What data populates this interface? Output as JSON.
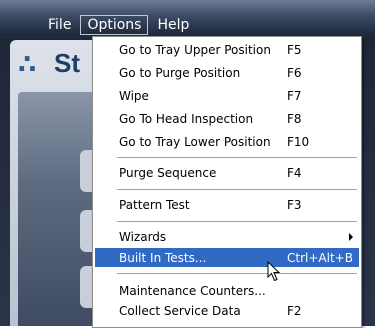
{
  "menubar": {
    "items": [
      {
        "label": "File"
      },
      {
        "label": "Options"
      },
      {
        "label": "Help"
      }
    ]
  },
  "app": {
    "logo_text": "St"
  },
  "options_menu": {
    "groups": [
      [
        {
          "label": "Go to Tray Upper Position",
          "shortcut": "F5"
        },
        {
          "label": "Go to Purge Position",
          "shortcut": "F6"
        },
        {
          "label": "Wipe",
          "shortcut": "F7"
        },
        {
          "label": "Go To Head Inspection",
          "shortcut": "F8"
        },
        {
          "label": "Go to Tray Lower Position",
          "shortcut": "F10"
        }
      ],
      [
        {
          "label": "Purge Sequence",
          "shortcut": "F4"
        }
      ],
      [
        {
          "label": "Pattern Test",
          "shortcut": "F3"
        }
      ],
      [
        {
          "label": "Wizards",
          "shortcut": "",
          "submenu": true
        },
        {
          "label": "Built In Tests...",
          "shortcut": "Ctrl+Alt+B",
          "highlighted": true
        }
      ],
      [
        {
          "label": "Maintenance Counters...",
          "shortcut": ""
        },
        {
          "label": "Collect Service Data",
          "shortcut": "F2"
        }
      ]
    ]
  },
  "colors": {
    "highlight": "#316ac5",
    "menu_background": "#ffffff",
    "titlebar": "#1d2638"
  },
  "icons": {
    "cursor": "arrow-cursor-icon",
    "submenu": "submenu-arrow-icon"
  }
}
